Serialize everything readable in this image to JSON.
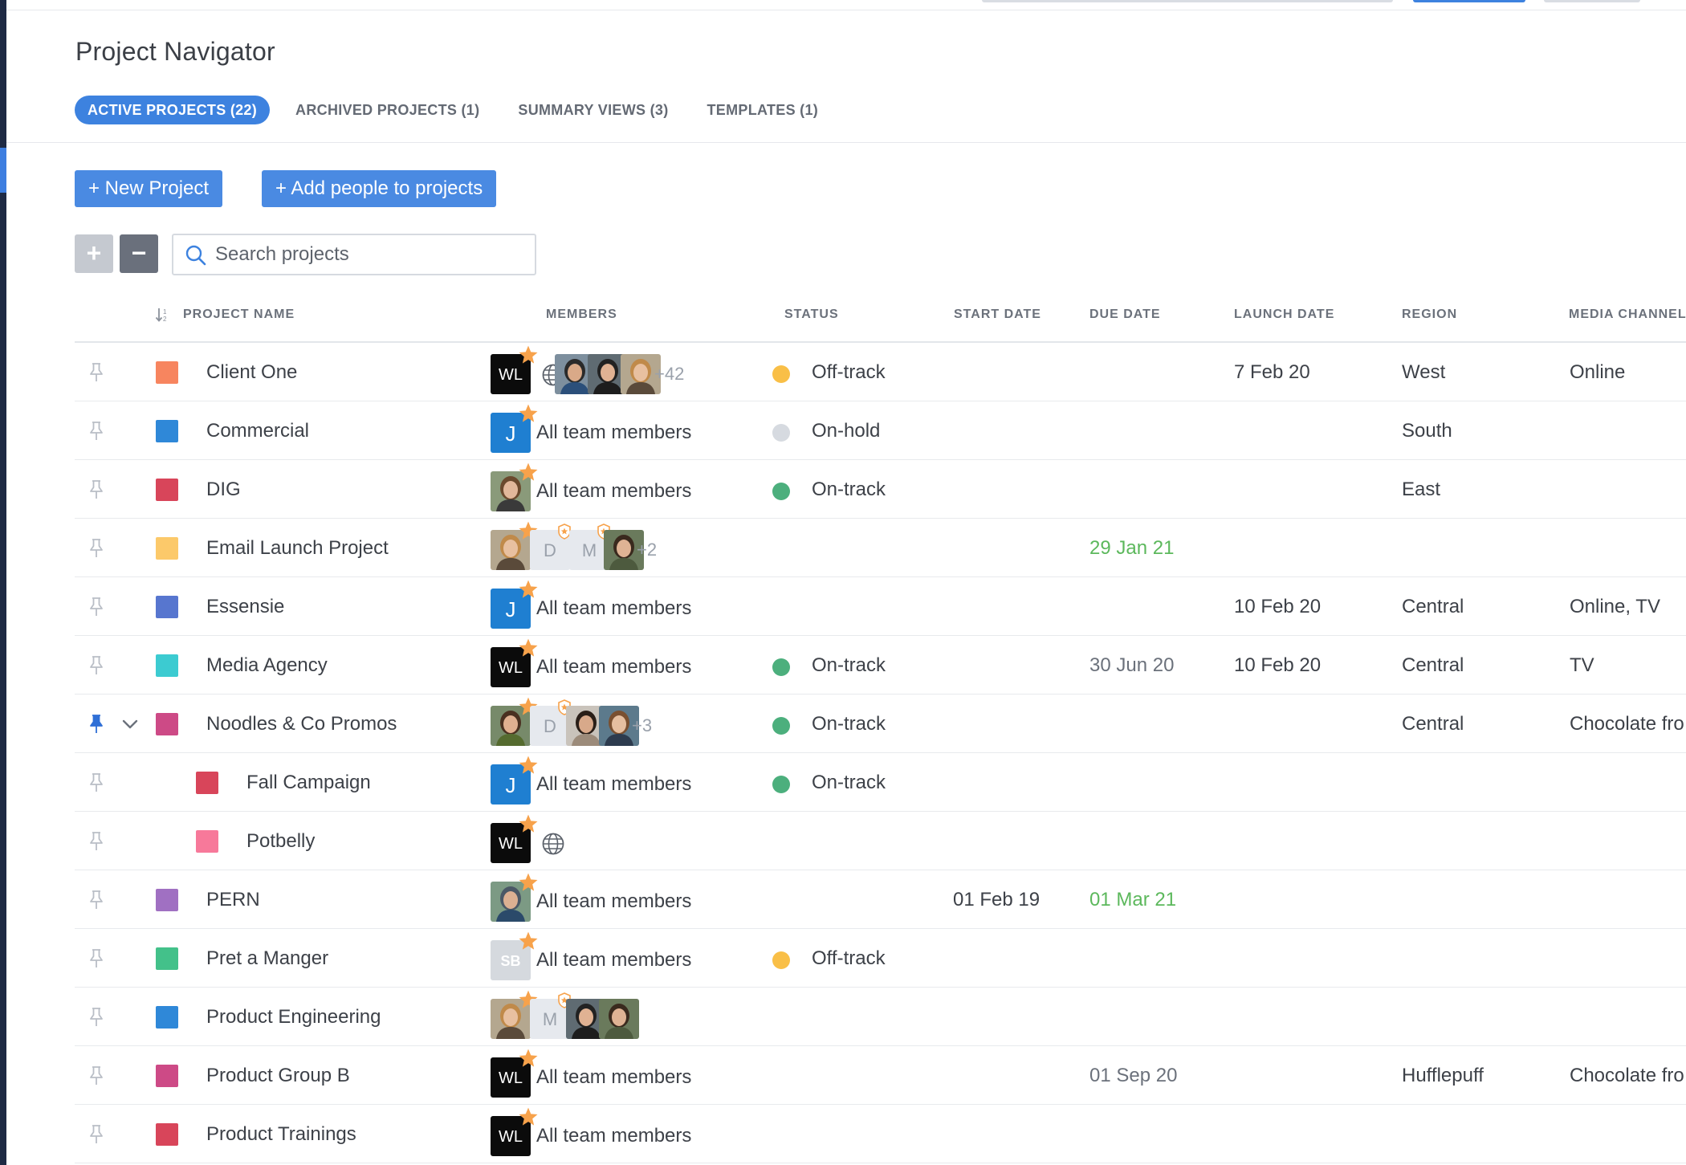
{
  "page": {
    "title": "Project Navigator"
  },
  "tabs": [
    {
      "label": "ACTIVE PROJECTS (22)",
      "active": true
    },
    {
      "label": "ARCHIVED PROJECTS (1)",
      "active": false
    },
    {
      "label": "SUMMARY VIEWS (3)",
      "active": false
    },
    {
      "label": "TEMPLATES (1)",
      "active": false
    }
  ],
  "toolbar": {
    "new_project_label": "+ New Project",
    "add_people_label": "+ Add people to projects",
    "expand_label": "+",
    "collapse_label": "−"
  },
  "search": {
    "placeholder": "Search projects",
    "value": ""
  },
  "table": {
    "columns": {
      "project_name": "PROJECT NAME",
      "members": "MEMBERS",
      "status": "STATUS",
      "start_date": "START DATE",
      "due_date": "DUE DATE",
      "launch_date": "LAUNCH DATE",
      "region": "REGION",
      "media_channel": "MEDIA CHANNEL"
    },
    "rows": [
      {
        "name": "Client One",
        "color": "#f7855f",
        "members_text": "",
        "more": "+42",
        "status": "Off-track",
        "status_color": "#f9bf47",
        "start": "",
        "due": "",
        "launch": "7 Feb 20",
        "region": "West",
        "media": "Online"
      },
      {
        "name": "Commercial",
        "color": "#2f88d8",
        "members_text": "All team members",
        "more": "",
        "status": "On-hold",
        "status_color": "#d6dae0",
        "start": "",
        "due": "",
        "launch": "",
        "region": "South",
        "media": ""
      },
      {
        "name": "DIG",
        "color": "#d8455a",
        "members_text": "All team members",
        "more": "",
        "status": "On-track",
        "status_color": "#4caf7d",
        "start": "",
        "due": "",
        "launch": "",
        "region": "East",
        "media": ""
      },
      {
        "name": "Email Launch Project",
        "color": "#fcc96a",
        "members_text": "",
        "more": "+2",
        "status": "",
        "status_color": "",
        "start": "",
        "due": "29 Jan 21",
        "launch": "",
        "region": "",
        "media": ""
      },
      {
        "name": "Essensie",
        "color": "#5776cf",
        "members_text": "All team members",
        "more": "",
        "status": "",
        "status_color": "",
        "start": "",
        "due": "",
        "launch": "10 Feb 20",
        "region": "Central",
        "media": "Online, TV"
      },
      {
        "name": "Media Agency",
        "color": "#3ccbd1",
        "members_text": "All team members",
        "more": "",
        "status": "On-track",
        "status_color": "#4caf7d",
        "start": "",
        "due": "30 Jun 20",
        "launch": "10 Feb 20",
        "region": "Central",
        "media": "TV"
      },
      {
        "name": "Noodles & Co Promos",
        "color": "#cd4a86",
        "members_text": "",
        "more": "+3",
        "status": "On-track",
        "status_color": "#4caf7d",
        "start": "",
        "due": "",
        "launch": "",
        "region": "Central",
        "media": "Chocolate fro"
      },
      {
        "name": "Fall Campaign",
        "color": "#d8455a",
        "members_text": "All team members",
        "more": "",
        "status": "On-track",
        "status_color": "#4caf7d",
        "start": "",
        "due": "",
        "launch": "",
        "region": "",
        "media": ""
      },
      {
        "name": "Potbelly",
        "color": "#f7799a",
        "members_text": "",
        "more": "",
        "status": "",
        "status_color": "",
        "start": "",
        "due": "",
        "launch": "",
        "region": "",
        "media": ""
      },
      {
        "name": "PERN",
        "color": "#a070c2",
        "members_text": "All team members",
        "more": "",
        "status": "",
        "status_color": "",
        "start": "01 Feb 19",
        "due": "01 Mar 21",
        "launch": "",
        "region": "",
        "media": ""
      },
      {
        "name": "Pret a Manger",
        "color": "#43c18a",
        "members_text": "All team members",
        "more": "",
        "status": "Off-track",
        "status_color": "#f9bf47",
        "start": "",
        "due": "",
        "launch": "",
        "region": "",
        "media": ""
      },
      {
        "name": "Product Engineering",
        "color": "#2f88d8",
        "members_text": "",
        "more": "",
        "status": "",
        "status_color": "",
        "start": "",
        "due": "",
        "launch": "",
        "region": "",
        "media": ""
      },
      {
        "name": "Product Group B",
        "color": "#cd4a86",
        "members_text": "All team members",
        "more": "",
        "status": "",
        "status_color": "",
        "start": "",
        "due": "01 Sep 20",
        "launch": "",
        "region": "Hufflepuff",
        "media": "Chocolate fro"
      },
      {
        "name": "Product Trainings",
        "color": "#d8455a",
        "members_text": "All team members",
        "more": "",
        "status": "",
        "status_color": "",
        "start": "",
        "due": "",
        "launch": "",
        "region": "",
        "media": ""
      }
    ]
  },
  "avatars": {
    "wl": "WL",
    "j": "J",
    "sb": "SB",
    "d": "D",
    "m": "M"
  },
  "colors": {
    "accent": "#3d82df",
    "button": "#4a8ae2",
    "star": "#f7a24b",
    "pinned": "#2f6fd6",
    "due_future": "#5cb85c"
  }
}
